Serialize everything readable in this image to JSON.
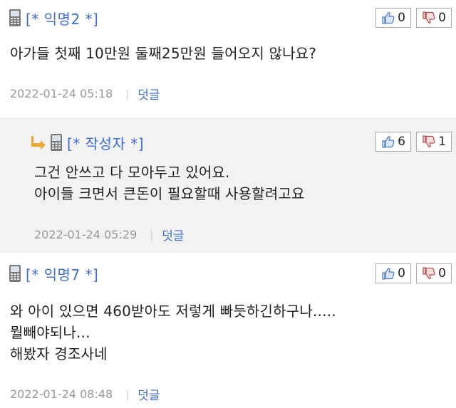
{
  "comments": [
    {
      "author": "[* 익명2 *]",
      "likes": "0",
      "dislikes": "0",
      "lines": [
        "아가들 첫째 10만원 둘째25만원 들어오지 않나요?"
      ],
      "date": "2022-01-24 05:18",
      "reply_label": "덧글"
    },
    {
      "author": "[* 작성자 *]",
      "likes": "6",
      "dislikes": "1",
      "lines": [
        "그건 안쓰고 다 모아두고 있어요.",
        "아이들 크면서 큰돈이 필요할때 사용할려고요"
      ],
      "date": "2022-01-24 05:29",
      "reply_label": "덧글"
    },
    {
      "author": "[* 익명7 *]",
      "likes": "0",
      "dislikes": "0",
      "lines": [
        "와 아이 있으면 460받아도 저렇게 빠듯하긴하구나.....",
        "뭘빼야되나...",
        "해봤자 경조사네"
      ],
      "date": "2022-01-24 08:48",
      "reply_label": "덧글"
    }
  ],
  "icons": {
    "device": "phone-icon",
    "reply_arrow": "reply-arrow-icon",
    "like": "thumbs-up-icon",
    "dislike": "thumbs-down-icon"
  },
  "colors": {
    "author": "#3f6fd1",
    "reply_link": "#3f6fd1",
    "reply_bg": "#f2f2f2",
    "meta_text": "#999999",
    "arrow": "#f0a830"
  }
}
